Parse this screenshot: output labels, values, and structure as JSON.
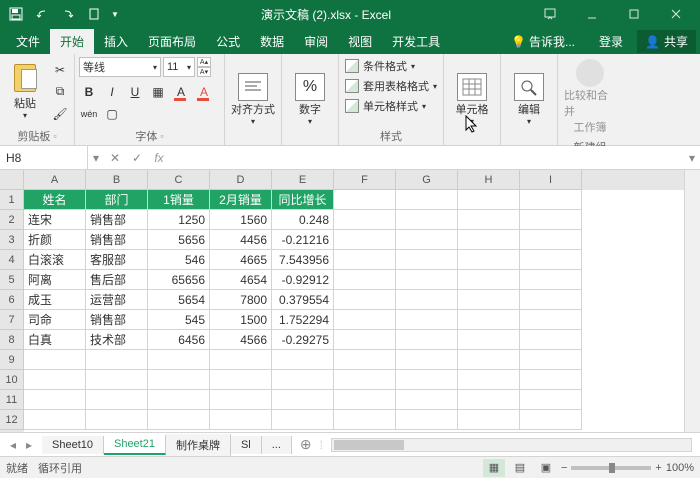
{
  "app": {
    "title": "演示文稿 (2).xlsx - Excel"
  },
  "tabs": {
    "file": "文件",
    "home": "开始",
    "insert": "插入",
    "layout": "页面布局",
    "formula": "公式",
    "data": "数据",
    "review": "审阅",
    "view": "视图",
    "dev": "开发工具",
    "tellme": "告诉我...",
    "login": "登录",
    "share": "共享"
  },
  "ribbon": {
    "clipboard": {
      "paste": "粘贴",
      "label": "剪贴板"
    },
    "font": {
      "name": "等线",
      "size": "11",
      "label": "字体",
      "ruby": "wén"
    },
    "align": {
      "label": "对齐方式"
    },
    "number": {
      "label": "数字",
      "pct": "%"
    },
    "styles": {
      "cond": "条件格式",
      "table": "套用表格格式",
      "cell": "单元格样式",
      "label": "样式"
    },
    "cells": {
      "label": "单元格"
    },
    "editing": {
      "label": "编辑"
    },
    "newgroup": {
      "compare": "比较和合并",
      "workbook": "工作簿",
      "label": "新建组"
    }
  },
  "namebox": "H8",
  "columns": [
    "A",
    "B",
    "C",
    "D",
    "E",
    "F",
    "G",
    "H",
    "I"
  ],
  "rownums": [
    "1",
    "2",
    "3",
    "4",
    "5",
    "6",
    "7",
    "8",
    "9",
    "10",
    "11",
    "12"
  ],
  "chart_data": {
    "type": "table",
    "headers": [
      "姓名",
      "部门",
      "1销量",
      "2月销量",
      "同比增长"
    ],
    "rows": [
      [
        "连宋",
        "销售部",
        "1250",
        "1560",
        "0.248"
      ],
      [
        "折颜",
        "销售部",
        "5656",
        "4456",
        "-0.21216"
      ],
      [
        "白滚滚",
        "客服部",
        "546",
        "4665",
        "7.543956"
      ],
      [
        "阿离",
        "售后部",
        "65656",
        "4654",
        "-0.92912"
      ],
      [
        "成玉",
        "运营部",
        "5654",
        "7800",
        "0.379554"
      ],
      [
        "司命",
        "销售部",
        "545",
        "1500",
        "1.752294"
      ],
      [
        "白真",
        "技术部",
        "6456",
        "4566",
        "-0.29275"
      ]
    ]
  },
  "sheets": {
    "s1": "Sheet10",
    "s2": "Sheet21",
    "s3": "制作桌牌",
    "s4": "Sl",
    "more": "..."
  },
  "status": {
    "ready": "就绪",
    "circ": "循环引用",
    "zoom": "100%"
  }
}
